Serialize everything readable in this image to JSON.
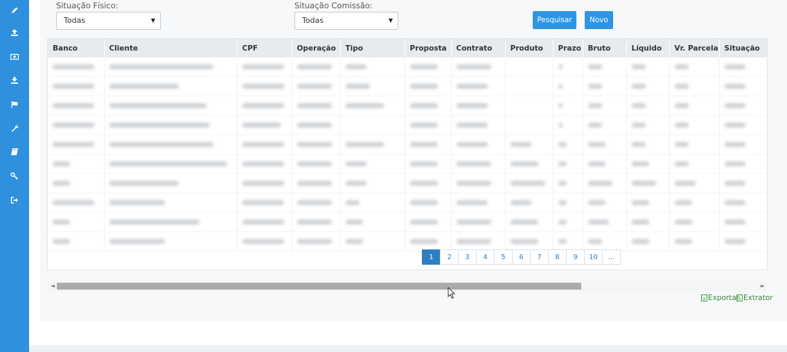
{
  "sidebar": {
    "items": [
      {
        "icon": "pencil-icon"
      },
      {
        "icon": "upload-icon"
      },
      {
        "icon": "money-icon"
      },
      {
        "icon": "download-icon"
      },
      {
        "icon": "flag-icon"
      },
      {
        "icon": "wrench-icon"
      },
      {
        "icon": "book-icon"
      },
      {
        "icon": "key-icon"
      },
      {
        "icon": "sign-out-icon"
      }
    ]
  },
  "filters": {
    "fisico_label": "Situação Físico:",
    "fisico_value": "Todas",
    "comissao_label": "Situação Comissão:",
    "comissao_value": "Todas"
  },
  "buttons": {
    "pesquisar": "Pesquisar",
    "novo": "Novo"
  },
  "table": {
    "columns": [
      "Banco",
      "Cliente",
      "CPF",
      "Operação",
      "Tipo",
      "Proposta",
      "Contrato",
      "Produto",
      "Prazo",
      "Bruto",
      "Líquido",
      "Vr. Parcela",
      "Situação"
    ]
  },
  "pagination": {
    "pages": [
      "1",
      "2",
      "3",
      "4",
      "5",
      "6",
      "7",
      "8",
      "9",
      "10",
      "..."
    ],
    "active": "1"
  },
  "export": {
    "exportar": "Exportar",
    "extrator": "Extrator"
  },
  "colors": {
    "sidebar": "#2f91dd",
    "button": "#2d95e2",
    "pagination_active": "#2d7fc1"
  }
}
